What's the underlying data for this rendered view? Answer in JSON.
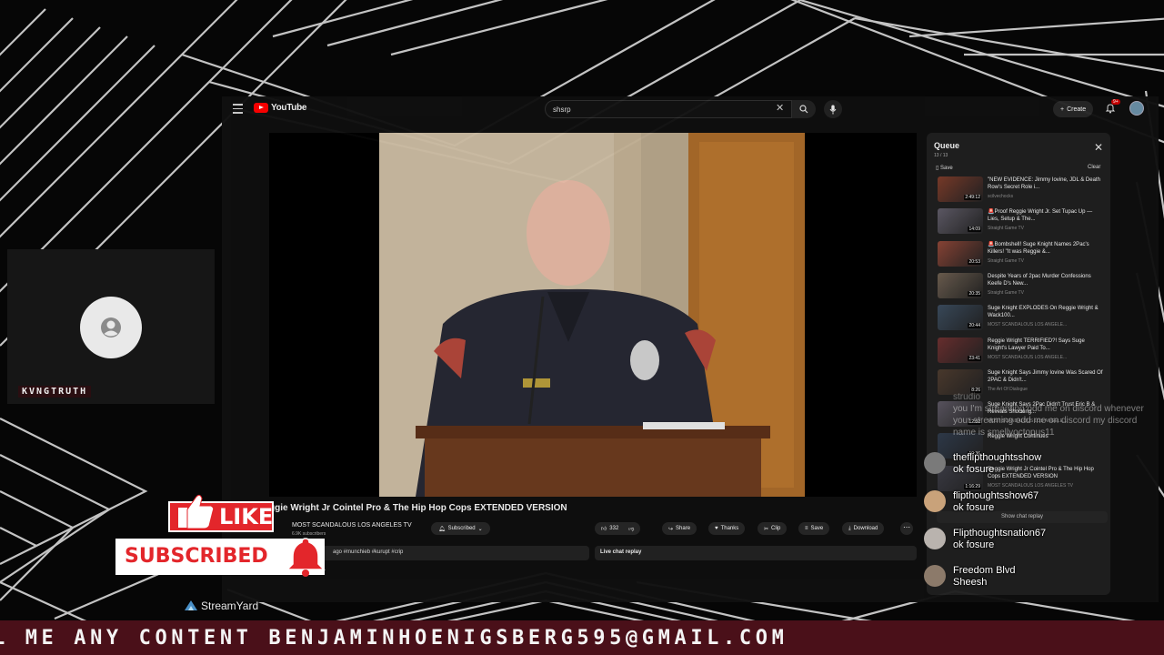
{
  "guest": {
    "name": "KVNGTRUTH"
  },
  "youtube": {
    "logo_text": "YouTube",
    "search_value": "shsrp",
    "create_label": "Create",
    "notification_count": "9+",
    "video": {
      "title": "ggie Wright Jr Cointel Pro & The Hip Hop Cops EXTENDED VERSION",
      "channel": "MOST SCANDALOUS LOS ANGELES TV",
      "subscribers": "6.9K subscribers",
      "subscribe_label": "Subscribed",
      "like_count": "332",
      "share_label": "Share",
      "thanks_label": "Thanks",
      "clip_label": "Clip",
      "save_label": "Save",
      "download_label": "Download",
      "description_snippet": "ago  #munchieb #kurupt #crip",
      "live_chat_label": "Live chat replay"
    },
    "queue": {
      "title": "Queue",
      "count": "13 / 13",
      "save_label": "Save",
      "clear_label": "Clear",
      "show_chat_replay": "Show chat replay",
      "items": [
        {
          "title": "\"NEW EVIDENCE: Jimmy Iovine, JDL & Death Row's Secret Role i...",
          "channel": "scilvechocks",
          "duration": "2:49:12"
        },
        {
          "title": "🚨Proof Reggie Wright Jr. Set Tupac Up — Lies, Setup & The...",
          "channel": "Straight Game TV",
          "duration": "14:09"
        },
        {
          "title": "🚨Bombshell! Suge Knight Names 2Pac's Killers! \"It was Reggie &...",
          "channel": "Straight Game TV",
          "duration": "20:53"
        },
        {
          "title": "Despite Years of 2pac Murder Confessions Keefe D's New...",
          "channel": "Straight Game TV",
          "duration": "20:35"
        },
        {
          "title": "Suge Knight EXPLODES On Reggie Wright & Wack100...",
          "channel": "MOST SCANDALOUS LOS ANGELE...",
          "duration": "20:44"
        },
        {
          "title": "Reggie Wright TERRIFIED?! Says Suge Knight's Lawyer Paid To...",
          "channel": "MOST SCANDALOUS LOS ANGELE...",
          "duration": "23:41"
        },
        {
          "title": "Suge Knight Says Jimmy Iovine Was Scared Of 2PAC & Didn't...",
          "channel": "The Art Of Dialogue",
          "duration": "8:26"
        },
        {
          "title": "Suge Knight Says 2Pac Didn't Trust Eric B & Reveals Shocking...",
          "channel": "MOST SCANDALOUS LOS ANGELE...",
          "duration": "12:02"
        },
        {
          "title": "Reggie Wright Continues",
          "channel": "",
          "duration": "10:36"
        },
        {
          "title": "Reggie Wright Jr Cointel Pro & The Hip Hop Cops EXTENDED VERSION",
          "channel": "MOST SCANDALOUS LOS ANGELES TV",
          "duration": "1:16:29"
        }
      ]
    }
  },
  "chat": {
    "ghost_user": "strudio",
    "ghost_message": "you I'm streaming odd me on discord whenever your streaming odd me on discord my discord name is smellyoctopus11",
    "messages": [
      {
        "user": "theflipthoughtsshow",
        "message": "ok fosure",
        "avatar_color": "#7a7a7a"
      },
      {
        "user": "flipthoughtsshow67",
        "message": "ok fosure",
        "avatar_color": "#c9a27a"
      },
      {
        "user": "Flipthoughtsnation67",
        "message": "ok fosure",
        "avatar_color": "#b9b3ae"
      },
      {
        "user": "Freedom Blvd",
        "message": "Sheesh",
        "avatar_color": "#8c7a6a"
      }
    ]
  },
  "overlay": {
    "like_label": "LIKE",
    "subscribed_label": "SUBSCRIBED",
    "streamyard_label": "StreamYard",
    "ticker_text": "L ME ANY CONTENT BENJAMINHOENIGSBERG595@GMAIL.COM",
    "brand_red": "#e3262b",
    "ticker_bg": "#4a1019"
  }
}
